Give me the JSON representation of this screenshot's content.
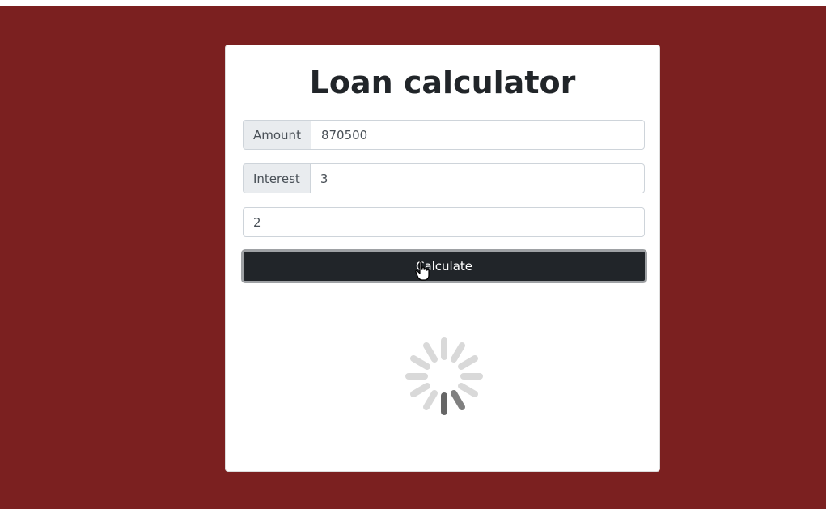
{
  "page": {
    "background_color": "#7b2020"
  },
  "card": {
    "title": "Loan calculator",
    "amount": {
      "label": "Amount",
      "value": "870500"
    },
    "interest": {
      "label": "Interest",
      "value": "3"
    },
    "years": {
      "value": "2"
    },
    "calculate_button": {
      "label": "Calculate"
    },
    "loading": {
      "icon": "spinner-icon"
    }
  }
}
